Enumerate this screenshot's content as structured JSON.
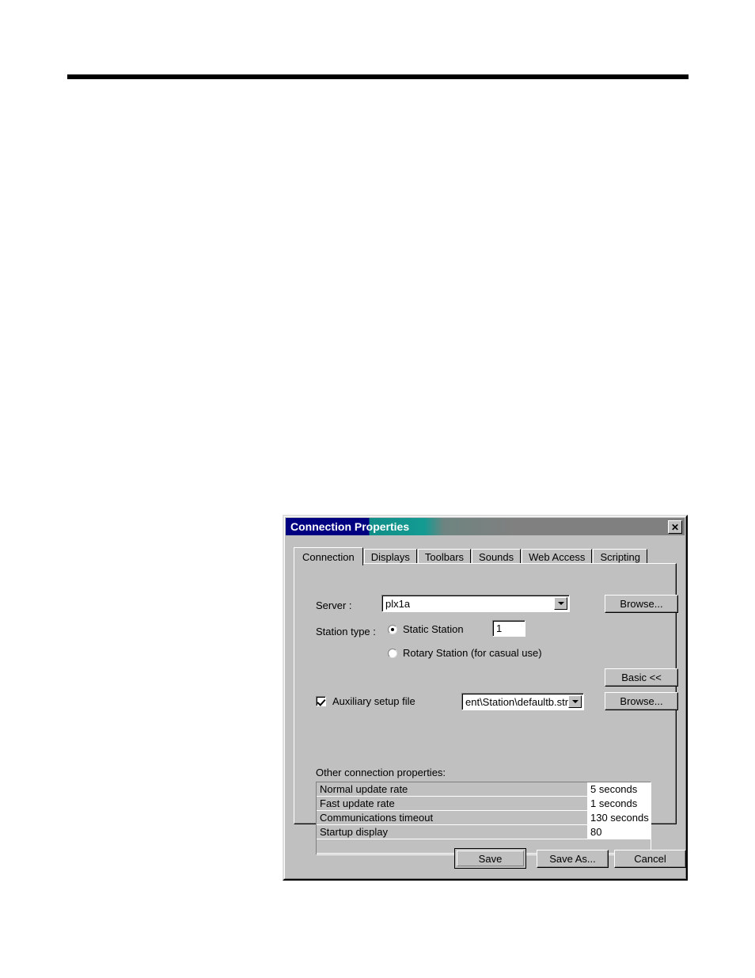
{
  "page": {
    "rule_present": true
  },
  "dialog": {
    "title": "Connection Properties",
    "title_part_1": "Connection",
    "title_part_2": "Properties",
    "close_icon": "close-icon",
    "close_glyph": "✕",
    "colors": {
      "title_navy": "#000080",
      "title_teal": "#118e88",
      "title_gray": "#808080",
      "face": "#c0c0c0",
      "field": "#ffffff"
    },
    "tabs": [
      {
        "label": "Connection",
        "active": true
      },
      {
        "label": "Displays",
        "active": false
      },
      {
        "label": "Toolbars",
        "active": false
      },
      {
        "label": "Sounds",
        "active": false
      },
      {
        "label": "Web Access",
        "active": false
      },
      {
        "label": "Scripting",
        "active": false
      }
    ],
    "form": {
      "server_label": "Server :",
      "server_value": "plx1a",
      "server_browse_label": "Browse...",
      "station_type_label": "Station type :",
      "static_station_label": "Static Station",
      "static_station_selected": true,
      "station_number_value": "1",
      "rotary_station_label": "Rotary Station (for casual use)",
      "rotary_station_selected": false,
      "basic_button_label": "Basic <<",
      "aux_setup_label": "Auxiliary setup file",
      "aux_setup_checked": true,
      "aux_setup_value": "ent\\Station\\defaultb.stn",
      "aux_browse_label": "Browse...",
      "other_props_label": "Other connection properties:"
    },
    "properties": {
      "rows": [
        {
          "key": "Normal update rate",
          "value": "5  seconds"
        },
        {
          "key": "Fast update rate",
          "value": "1  seconds"
        },
        {
          "key": "Communications timeout",
          "value": "130 seconds"
        },
        {
          "key": "Startup display",
          "value": "80"
        }
      ]
    },
    "buttons": {
      "save": "Save",
      "save_as": "Save As...",
      "cancel": "Cancel"
    }
  }
}
